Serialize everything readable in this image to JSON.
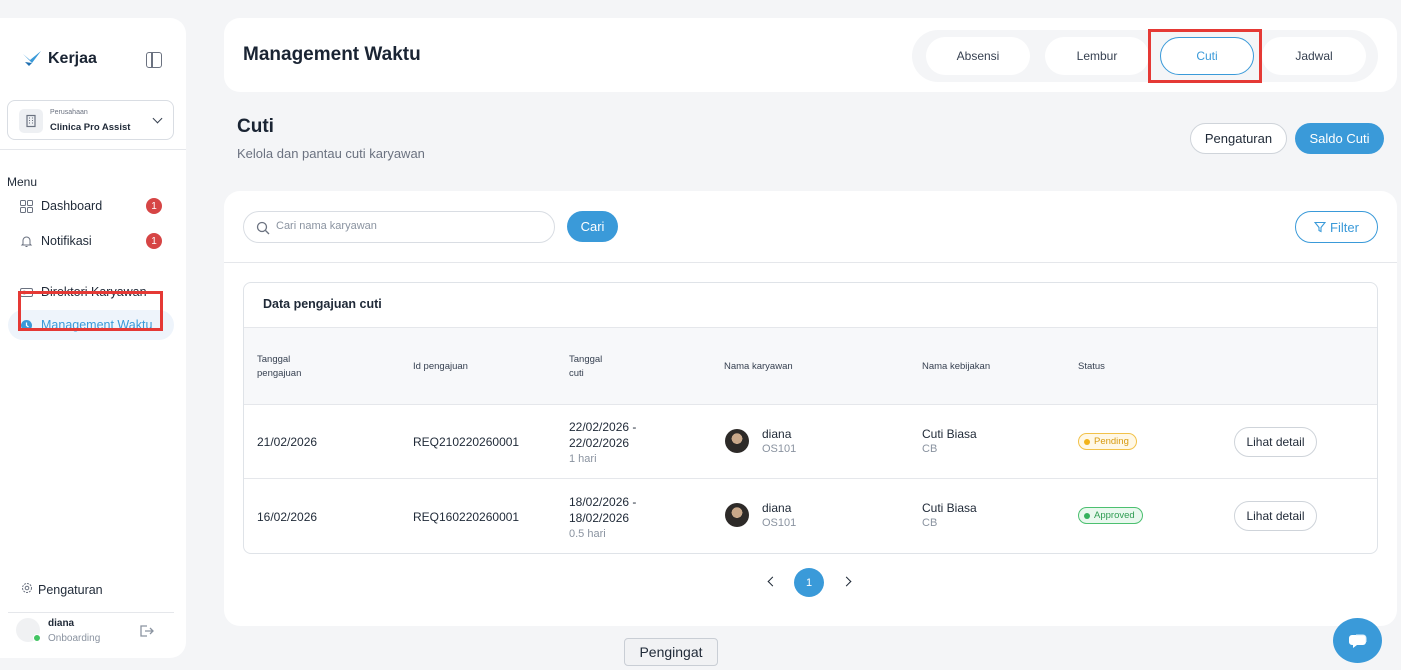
{
  "brand": {
    "name": "Kerjaa"
  },
  "company": {
    "label": "Perusahaan",
    "name": "Clinica Pro Assist"
  },
  "sidebar": {
    "menu_label": "Menu",
    "items": [
      {
        "label": "Dashboard",
        "badge": "1"
      },
      {
        "label": "Notifikasi",
        "badge": "1"
      },
      {
        "label": "Direktori Karyawan"
      },
      {
        "label": "Management Waktu"
      }
    ],
    "settings_label": "Pengaturan"
  },
  "user": {
    "name": "diana",
    "role": "Onboarding"
  },
  "header": {
    "title": "Management Waktu",
    "tabs": [
      "Absensi",
      "Lembur",
      "Cuti",
      "Jadwal"
    ]
  },
  "page": {
    "title": "Cuti",
    "subtitle": "Kelola dan pantau cuti karyawan",
    "settings_button": "Pengaturan",
    "balance_button": "Saldo Cuti"
  },
  "search": {
    "placeholder": "Cari nama karyawan",
    "button": "Cari",
    "filter": "Filter"
  },
  "table": {
    "title": "Data pengajuan cuti",
    "columns": [
      "Tanggal pengajuan",
      "Id pengajuan",
      "Tanggal cuti",
      "Nama karyawan",
      "Nama kebijakan",
      "Status"
    ],
    "rows": [
      {
        "submitted": "21/02/2026",
        "id": "REQ210220260001",
        "date_from": "22/02/2026 -",
        "date_to": "22/02/2026",
        "duration": "1 hari",
        "employee": "diana",
        "employee_code": "OS101",
        "policy": "Cuti Biasa",
        "policy_code": "CB",
        "status": "Pending",
        "action": "Lihat detail"
      },
      {
        "submitted": "16/02/2026",
        "id": "REQ160220260001",
        "date_from": "18/02/2026 -",
        "date_to": "18/02/2026",
        "duration": "0.5 hari",
        "employee": "diana",
        "employee_code": "OS101",
        "policy": "Cuti Biasa",
        "policy_code": "CB",
        "status": "Approved",
        "action": "Lihat detail"
      }
    ]
  },
  "pagination": {
    "current": "1"
  },
  "tooltip": "Pengingat",
  "colors": {
    "accent": "#3a9ad9",
    "badge": "#d64545",
    "highlight": "#e53935"
  }
}
